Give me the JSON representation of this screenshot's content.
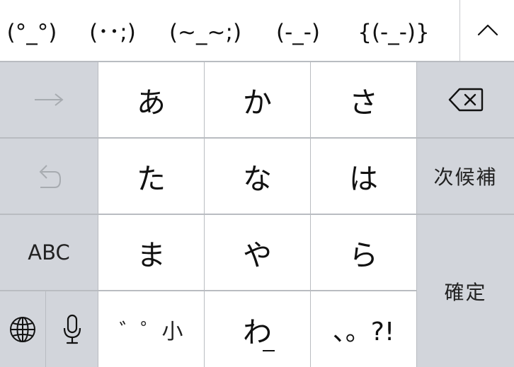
{
  "candidates": [
    "(°_°)",
    "(･･;)",
    "(~_~;)",
    "(-_-)",
    "{(-_-)}"
  ],
  "expand_icon": "chevron-up-icon",
  "keys": {
    "row1": {
      "left_icon": "arrow-right-icon",
      "a": "あ",
      "ka": "か",
      "sa": "さ",
      "right_icon": "backspace-icon"
    },
    "row2": {
      "left_icon": "undo-icon",
      "ta": "た",
      "na": "な",
      "ha": "は",
      "right_label": "次候補"
    },
    "row3": {
      "left_label": "ABC",
      "ma": "ま",
      "ya": "や",
      "ra": "ら"
    },
    "row4": {
      "globe_icon": "globe-icon",
      "mic_icon": "microphone-icon",
      "dakuten": "゛゜小",
      "wa": "わ",
      "punct": "、。?!"
    },
    "confirm_label": "確定"
  },
  "colors": {
    "light_key": "#ffffff",
    "dark_key": "#d2d5db",
    "separator": "#b9bcc1",
    "icon_grey": "#a7abb0"
  }
}
